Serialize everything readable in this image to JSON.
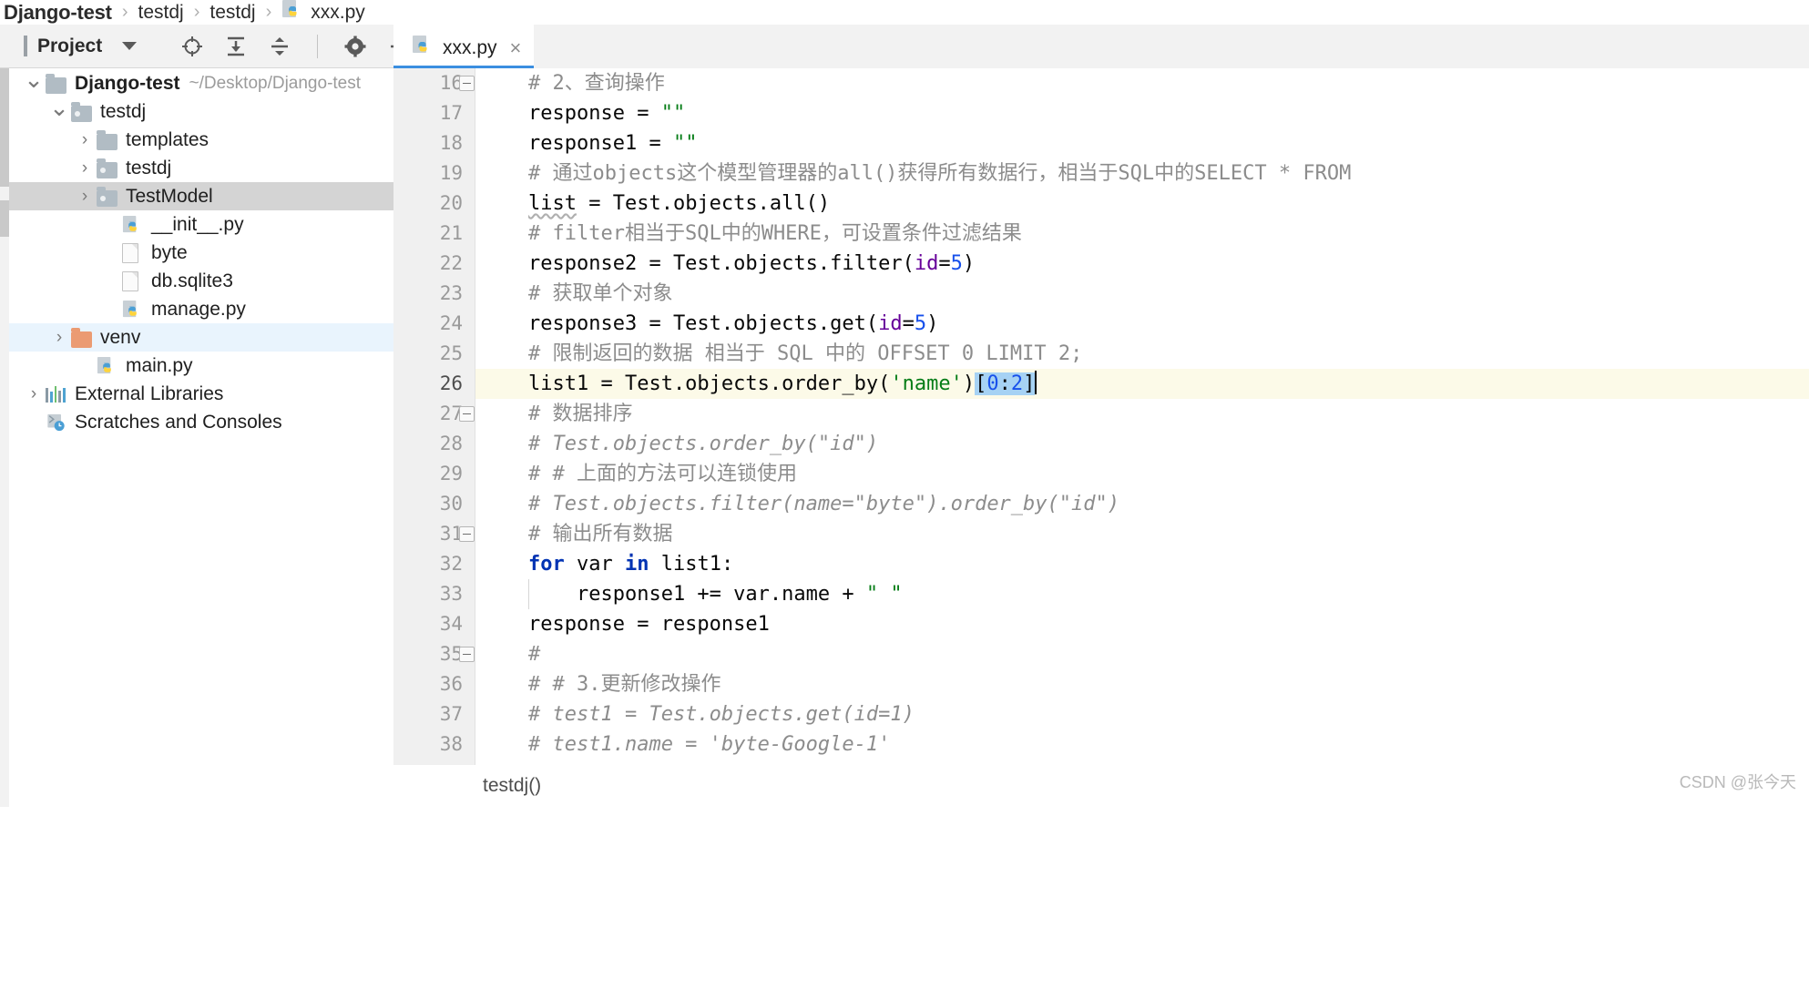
{
  "breadcrumb": {
    "items": [
      {
        "label": "Django-test",
        "bold": true
      },
      {
        "label": "testdj",
        "bold": false
      },
      {
        "label": "testdj",
        "bold": false
      },
      {
        "label": "xxx.py",
        "bold": false,
        "icon": "python-file-icon"
      }
    ],
    "separator": "›"
  },
  "toolwindow": {
    "title": "Project",
    "dropdown_caret": "caret-down-icon",
    "icons": [
      "locate-target-icon",
      "expand-all-icon",
      "collapse-all-icon",
      "settings-gear-icon",
      "hide-minimize-icon"
    ]
  },
  "tree": {
    "items": [
      {
        "label": "Django-test",
        "path": "~/Desktop/Django-test",
        "indent": 0,
        "twisty": "⌄",
        "icon": "folder-icon",
        "bold": true,
        "state": "none"
      },
      {
        "label": "testdj",
        "path": "",
        "indent": 1,
        "twisty": "⌄",
        "icon": "folder-module-icon",
        "bold": false,
        "state": "none"
      },
      {
        "label": "templates",
        "path": "",
        "indent": 2,
        "twisty": "›",
        "icon": "folder-icon",
        "bold": false,
        "state": "none"
      },
      {
        "label": "testdj",
        "path": "",
        "indent": 2,
        "twisty": "›",
        "icon": "folder-module-icon",
        "bold": false,
        "state": "none"
      },
      {
        "label": "TestModel",
        "path": "",
        "indent": 2,
        "twisty": "›",
        "icon": "folder-module-icon",
        "bold": false,
        "state": "selected-grey"
      },
      {
        "label": "__init__.py",
        "path": "",
        "indent": 3,
        "twisty": "",
        "icon": "python-file-icon",
        "bold": false,
        "state": "none"
      },
      {
        "label": "byte",
        "path": "",
        "indent": 3,
        "twisty": "",
        "icon": "file-icon",
        "bold": false,
        "state": "none"
      },
      {
        "label": "db.sqlite3",
        "path": "",
        "indent": 3,
        "twisty": "",
        "icon": "file-icon",
        "bold": false,
        "state": "none"
      },
      {
        "label": "manage.py",
        "path": "",
        "indent": 3,
        "twisty": "",
        "icon": "python-file-icon",
        "bold": false,
        "state": "none"
      },
      {
        "label": "venv",
        "path": "",
        "indent": 1,
        "twisty": "›",
        "icon": "folder-orange-icon",
        "bold": false,
        "state": "selected-blue"
      },
      {
        "label": "main.py",
        "path": "",
        "indent": 2,
        "twisty": "",
        "icon": "python-file-icon",
        "bold": false,
        "state": "none"
      },
      {
        "label": "External Libraries",
        "path": "",
        "indent": 0,
        "twisty": "›",
        "icon": "library-icon",
        "bold": false,
        "state": "none"
      },
      {
        "label": "Scratches and Consoles",
        "path": "",
        "indent": 0,
        "twisty": "",
        "icon": "scratches-icon",
        "bold": false,
        "state": "none"
      }
    ]
  },
  "editor": {
    "tab": {
      "title": "xxx.py",
      "icon": "python-file-icon",
      "close": "×"
    },
    "first_line": 16,
    "lines": [
      {
        "n": 16,
        "fold": true,
        "indent_guide": false,
        "tokens": [
          {
            "t": "# 2、查询操作",
            "c": "c-cmt-cn"
          }
        ]
      },
      {
        "n": 17,
        "fold": false,
        "indent_guide": false,
        "tokens": [
          {
            "t": "response = ",
            "c": "c-plain"
          },
          {
            "t": "\"\"",
            "c": "c-str"
          }
        ]
      },
      {
        "n": 18,
        "fold": false,
        "indent_guide": false,
        "tokens": [
          {
            "t": "response1 = ",
            "c": "c-plain"
          },
          {
            "t": "\"\"",
            "c": "c-str"
          }
        ]
      },
      {
        "n": 19,
        "fold": false,
        "indent_guide": false,
        "tokens": [
          {
            "t": "# 通过objects这个模型管理器的all()获得所有数据行，相当于SQL中的SELECT * FROM",
            "c": "c-cmt-cn"
          }
        ]
      },
      {
        "n": 20,
        "fold": false,
        "indent_guide": false,
        "tokens": [
          {
            "t": "list",
            "c": "c-plain c-warn"
          },
          {
            "t": " = Test.objects.all()",
            "c": "c-plain"
          }
        ]
      },
      {
        "n": 21,
        "fold": false,
        "indent_guide": false,
        "tokens": [
          {
            "t": "# filter相当于SQL中的WHERE，可设置条件过滤结果",
            "c": "c-cmt-cn"
          }
        ]
      },
      {
        "n": 22,
        "fold": false,
        "indent_guide": false,
        "tokens": [
          {
            "t": "response2 = Test.objects.filter(",
            "c": "c-plain"
          },
          {
            "t": "id",
            "c": "c-kwarg"
          },
          {
            "t": "=",
            "c": "c-plain"
          },
          {
            "t": "5",
            "c": "c-num"
          },
          {
            "t": ")",
            "c": "c-plain"
          }
        ]
      },
      {
        "n": 23,
        "fold": false,
        "indent_guide": false,
        "tokens": [
          {
            "t": "# 获取单个对象",
            "c": "c-cmt-cn"
          }
        ]
      },
      {
        "n": 24,
        "fold": false,
        "indent_guide": false,
        "tokens": [
          {
            "t": "response3 = Test.objects.get(",
            "c": "c-plain"
          },
          {
            "t": "id",
            "c": "c-kwarg"
          },
          {
            "t": "=",
            "c": "c-plain"
          },
          {
            "t": "5",
            "c": "c-num"
          },
          {
            "t": ")",
            "c": "c-plain"
          }
        ]
      },
      {
        "n": 25,
        "fold": false,
        "indent_guide": false,
        "tokens": [
          {
            "t": "# 限制返回的数据 相当于 SQL 中的 OFFSET 0 LIMIT 2;",
            "c": "c-cmt-cn"
          }
        ]
      },
      {
        "n": 26,
        "fold": false,
        "indent_guide": false,
        "highlight": true,
        "tokens": [
          {
            "t": "list1 = Test.objects.order_by(",
            "c": "c-plain"
          },
          {
            "t": "'name'",
            "c": "c-str"
          },
          {
            "t": ")",
            "c": "c-plain"
          },
          {
            "t": "[",
            "c": "c-plain sel"
          },
          {
            "t": "0",
            "c": "c-num sel"
          },
          {
            "t": ":",
            "c": "c-plain sel"
          },
          {
            "t": "2",
            "c": "c-num sel"
          },
          {
            "t": "]",
            "c": "c-plain sel"
          }
        ],
        "caret": true
      },
      {
        "n": 27,
        "fold": true,
        "indent_guide": false,
        "tokens": [
          {
            "t": "# 数据排序",
            "c": "c-cmt-cn"
          }
        ]
      },
      {
        "n": 28,
        "fold": false,
        "indent_guide": false,
        "tokens": [
          {
            "t": "# Test.objects.order_by(\"id\")",
            "c": "c-cmt"
          }
        ]
      },
      {
        "n": 29,
        "fold": false,
        "indent_guide": false,
        "tokens": [
          {
            "t": "# # 上面的方法可以连锁使用",
            "c": "c-cmt-cn"
          }
        ]
      },
      {
        "n": 30,
        "fold": false,
        "indent_guide": false,
        "tokens": [
          {
            "t": "# Test.objects.filter(name=\"byte\").order_by(\"id\")",
            "c": "c-cmt"
          }
        ]
      },
      {
        "n": 31,
        "fold": true,
        "indent_guide": false,
        "tokens": [
          {
            "t": "# 输出所有数据",
            "c": "c-cmt-cn"
          }
        ]
      },
      {
        "n": 32,
        "fold": false,
        "indent_guide": false,
        "tokens": [
          {
            "t": "for",
            "c": "c-kw"
          },
          {
            "t": " var ",
            "c": "c-plain"
          },
          {
            "t": "in",
            "c": "c-kw"
          },
          {
            "t": " list1:",
            "c": "c-plain"
          }
        ]
      },
      {
        "n": 33,
        "fold": false,
        "indent_guide": true,
        "tokens": [
          {
            "t": "    response1 += var.name + ",
            "c": "c-plain"
          },
          {
            "t": "\" \"",
            "c": "c-str"
          }
        ]
      },
      {
        "n": 34,
        "fold": false,
        "indent_guide": false,
        "tokens": [
          {
            "t": "response = response1",
            "c": "c-plain"
          }
        ]
      },
      {
        "n": 35,
        "fold": true,
        "indent_guide": false,
        "tokens": [
          {
            "t": "#",
            "c": "c-cmt-cn"
          }
        ]
      },
      {
        "n": 36,
        "fold": false,
        "indent_guide": false,
        "tokens": [
          {
            "t": "# # 3.更新修改操作",
            "c": "c-cmt-cn"
          }
        ]
      },
      {
        "n": 37,
        "fold": false,
        "indent_guide": false,
        "tokens": [
          {
            "t": "# test1 = Test.objects.get(id=1)",
            "c": "c-cmt"
          }
        ]
      },
      {
        "n": 38,
        "fold": false,
        "indent_guide": false,
        "tokens": [
          {
            "t": "# test1.name = 'byte-Google-1'",
            "c": "c-cmt"
          }
        ]
      }
    ]
  },
  "status": {
    "bottom_breadcrumb": "testdj()",
    "watermark": "CSDN @张今天"
  },
  "colors": {
    "accent_tab": "#3b8ee0",
    "selection": "#a6d2f4",
    "current_line": "#fcfae8",
    "tree_selected_grey": "#d4d4d4",
    "tree_selected_blue": "#e9f4fd",
    "string": "#067d17",
    "keyword": "#0033b3",
    "number": "#1750eb",
    "kwarg": "#660099",
    "comment": "#8c8c8c"
  }
}
